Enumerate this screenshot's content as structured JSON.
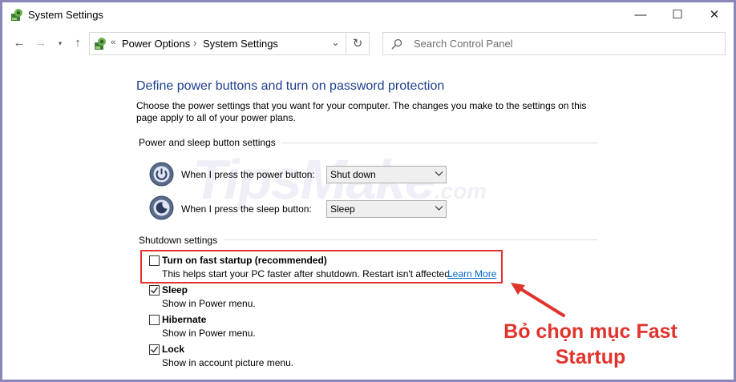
{
  "window": {
    "title": "System Settings",
    "controls": {
      "minimize": "—",
      "maximize": "☐",
      "close": "✕"
    }
  },
  "nav": {
    "back": "←",
    "forward": "→",
    "recent": "▾",
    "up": "↑",
    "breadcrumb_prefix": "«",
    "breadcrumb": [
      "Power Options",
      "System Settings"
    ],
    "separator": "›",
    "dropdown": "⌄",
    "refresh": "↻",
    "search_placeholder": "Search Control Panel"
  },
  "main": {
    "heading": "Define power buttons and turn on password protection",
    "description": "Choose the power settings that you want for your computer. The changes you make to the settings on this page apply to all of your power plans.",
    "power_section": {
      "title": "Power and sleep button settings",
      "rows": [
        {
          "label": "When I press the power button:",
          "value": "Shut down"
        },
        {
          "label": "When I press the sleep button:",
          "value": "Sleep"
        }
      ]
    },
    "shutdown_section": {
      "title": "Shutdown settings",
      "items": [
        {
          "label": "Turn on fast startup (recommended)",
          "description": "This helps start your PC faster after shutdown. Restart isn't affected.",
          "link": "Learn More",
          "checked": false
        },
        {
          "label": "Sleep",
          "description": "Show in Power menu.",
          "checked": true
        },
        {
          "label": "Hibernate",
          "description": "Show in Power menu.",
          "checked": false
        },
        {
          "label": "Lock",
          "description": "Show in account picture menu.",
          "checked": true
        }
      ]
    }
  },
  "annotation": {
    "line1": "Bỏ chọn mục Fast",
    "line2": "Startup",
    "color": "#e0332d"
  },
  "watermark": {
    "main": "TipsMake",
    "suffix": ".com"
  },
  "colors": {
    "heading": "#1e3f8f",
    "link": "#0066cc",
    "frame": "#8a86b8"
  }
}
